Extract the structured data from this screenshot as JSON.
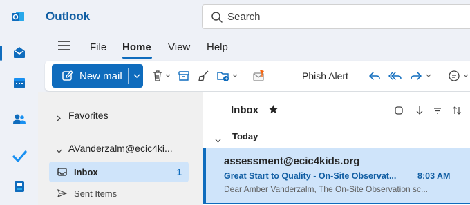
{
  "app": {
    "title": "Outlook"
  },
  "search": {
    "placeholder": "Search"
  },
  "menu": {
    "items": [
      {
        "label": "File"
      },
      {
        "label": "Home"
      },
      {
        "label": "View"
      },
      {
        "label": "Help"
      }
    ],
    "active": "Home"
  },
  "ribbon": {
    "new_mail_label": "New mail",
    "phish_alert_label": "Phish Alert"
  },
  "folders": {
    "favorites_label": "Favorites",
    "account_label": "AVanderzalm@ecic4ki...",
    "inbox_label": "Inbox",
    "inbox_count": "1",
    "sent_label": "Sent Items"
  },
  "message_list": {
    "title": "Inbox",
    "group_label": "Today",
    "message": {
      "from": "assessment@ecic4kids.org",
      "subject": "Great Start to Quality - On-Site Observat...",
      "time": "8:03 AM",
      "preview": "Dear Amber Vanderzalm, The On-Site Observation sc..."
    }
  },
  "colors": {
    "accent": "#0f6cbd",
    "selected_bg": "#cfe4fa",
    "chrome_bg": "#eef1f7"
  }
}
